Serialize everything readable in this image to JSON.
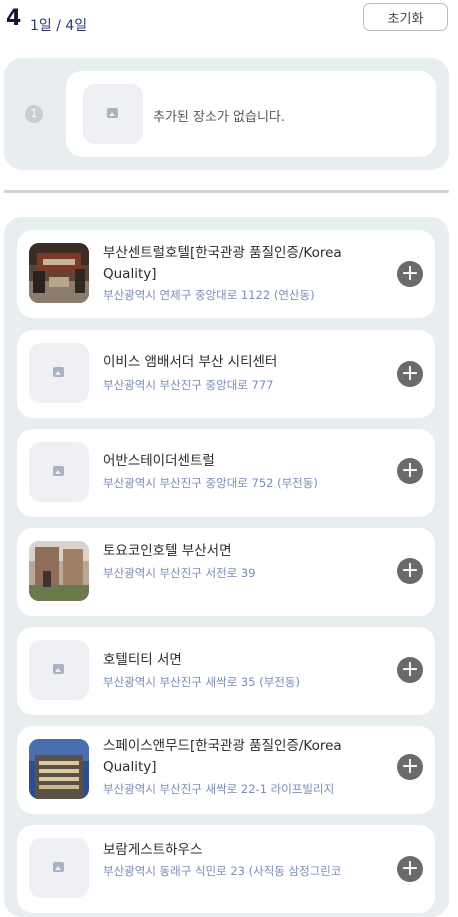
{
  "header": {
    "day_number": "4",
    "day_fraction": "1일 / 4일",
    "reset_label": "초기화"
  },
  "selected": {
    "order_number": "1",
    "empty_message": "추가된 장소가 없습니다."
  },
  "places": [
    {
      "name": "부산센트럴호텔[한국관광 품질인증/Korea Quality]",
      "address": "부산광역시 연제구 중앙대로 1122 (연산동)",
      "thumbnail": "photo"
    },
    {
      "name": "이비스 앰배서더 부산 시티센터",
      "address": "부산광역시 부산진구 중앙대로 777",
      "thumbnail": "placeholder"
    },
    {
      "name": "어반스테이더센트럴",
      "address": "부산광역시 부산진구 중앙대로 752 (부전동)",
      "thumbnail": "placeholder"
    },
    {
      "name": "토요코인호텔 부산서면",
      "address": "부산광역시 부산진구 서전로 39",
      "thumbnail": "photo"
    },
    {
      "name": "호텔티티 서면",
      "address": "부산광역시 부산진구 새싹로 35 (부전동)",
      "thumbnail": "placeholder"
    },
    {
      "name": "스페이스앤무드[한국관광 품질인증/Korea Quality]",
      "address": "부산광역시 부산진구 새싹로 22-1 라이프빌리지",
      "thumbnail": "photo"
    },
    {
      "name": "보람게스트하우스",
      "address": "부산광역시 동래구 식민로 23 (사직동 삼정그린코",
      "thumbnail": "placeholder"
    }
  ],
  "add_icon": "+",
  "colors": {
    "panel_bg": "#e8edf0",
    "address": "#7a8cb8",
    "add_button": "#6a6a6a",
    "day_title": "#141a35"
  }
}
